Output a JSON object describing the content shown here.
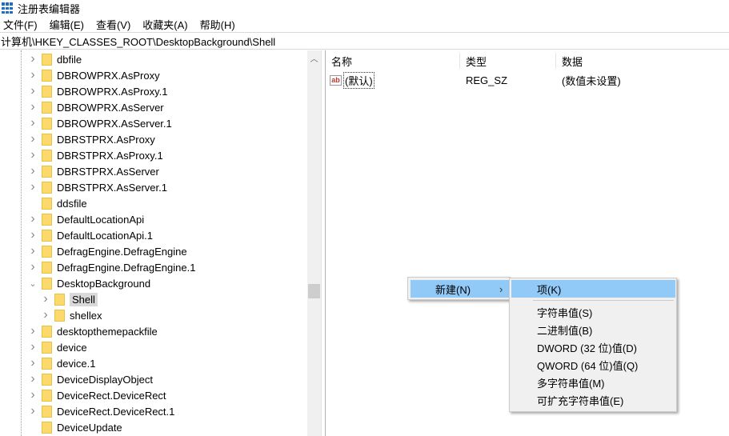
{
  "window": {
    "title": "注册表编辑器"
  },
  "menu": [
    "文件(F)",
    "编辑(E)",
    "查看(V)",
    "收藏夹(A)",
    "帮助(H)"
  ],
  "address": "计算机\\HKEY_CLASSES_ROOT\\DesktopBackground\\Shell",
  "tree": [
    {
      "label": "dbfile",
      "level": 1,
      "expander": "collapsed"
    },
    {
      "label": "DBROWPRX.AsProxy",
      "level": 1,
      "expander": "collapsed"
    },
    {
      "label": "DBROWPRX.AsProxy.1",
      "level": 1,
      "expander": "collapsed"
    },
    {
      "label": "DBROWPRX.AsServer",
      "level": 1,
      "expander": "collapsed"
    },
    {
      "label": "DBROWPRX.AsServer.1",
      "level": 1,
      "expander": "collapsed"
    },
    {
      "label": "DBRSTPRX.AsProxy",
      "level": 1,
      "expander": "collapsed"
    },
    {
      "label": "DBRSTPRX.AsProxy.1",
      "level": 1,
      "expander": "collapsed"
    },
    {
      "label": "DBRSTPRX.AsServer",
      "level": 1,
      "expander": "collapsed"
    },
    {
      "label": "DBRSTPRX.AsServer.1",
      "level": 1,
      "expander": "collapsed"
    },
    {
      "label": "ddsfile",
      "level": 1,
      "expander": "none"
    },
    {
      "label": "DefaultLocationApi",
      "level": 1,
      "expander": "collapsed"
    },
    {
      "label": "DefaultLocationApi.1",
      "level": 1,
      "expander": "collapsed"
    },
    {
      "label": "DefragEngine.DefragEngine",
      "level": 1,
      "expander": "collapsed"
    },
    {
      "label": "DefragEngine.DefragEngine.1",
      "level": 1,
      "expander": "collapsed"
    },
    {
      "label": "DesktopBackground",
      "level": 1,
      "expander": "expanded"
    },
    {
      "label": "Shell",
      "level": 2,
      "expander": "collapsed",
      "selected": true
    },
    {
      "label": "shellex",
      "level": 2,
      "expander": "collapsed"
    },
    {
      "label": "desktopthemepackfile",
      "level": 1,
      "expander": "collapsed"
    },
    {
      "label": "device",
      "level": 1,
      "expander": "collapsed"
    },
    {
      "label": "device.1",
      "level": 1,
      "expander": "collapsed"
    },
    {
      "label": "DeviceDisplayObject",
      "level": 1,
      "expander": "collapsed"
    },
    {
      "label": "DeviceRect.DeviceRect",
      "level": 1,
      "expander": "collapsed"
    },
    {
      "label": "DeviceRect.DeviceRect.1",
      "level": 1,
      "expander": "collapsed"
    },
    {
      "label": "DeviceUpdate",
      "level": 1,
      "expander": "none"
    }
  ],
  "columns": {
    "name": "名称",
    "type": "类型",
    "data": "数据"
  },
  "values": [
    {
      "icon": "ab",
      "name": "(默认)",
      "type": "REG_SZ",
      "data": "(数值未设置)"
    }
  ],
  "context_menu": {
    "new": "新建(N)",
    "arrow": "›"
  },
  "submenu": {
    "key": "项(K)",
    "items": [
      "字符串值(S)",
      "二进制值(B)",
      "DWORD (32 位)值(D)",
      "QWORD (64 位)值(Q)",
      "多字符串值(M)",
      "可扩充字符串值(E)"
    ]
  }
}
